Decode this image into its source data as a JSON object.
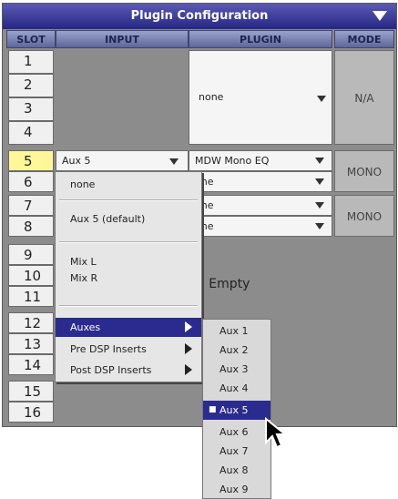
{
  "window": {
    "title": "Plugin Configuration"
  },
  "columns": {
    "slot": "SLOT",
    "input": "INPUT",
    "plugin": "PLUGIN",
    "mode": "MODE"
  },
  "slots": [
    "1",
    "2",
    "3",
    "4",
    "5",
    "6",
    "7",
    "8",
    "9",
    "10",
    "11",
    "12",
    "13",
    "14",
    "15",
    "16"
  ],
  "selected_slot": "5",
  "plugin_group1": {
    "value": "none",
    "mode": "N/A"
  },
  "row5": {
    "input": "Aux 5",
    "plugin": "MDW Mono EQ",
    "mode": "MONO"
  },
  "rows6to8": {
    "plugin6": "one",
    "plugin7": "one",
    "plugin8": "one",
    "mode": "MONO"
  },
  "empty_label": "C Empty",
  "input_menu": {
    "items": [
      "none",
      "Aux 5 (default)",
      "Mix L",
      "Mix R",
      "Auxes",
      "Pre DSP Inserts",
      "Post DSP Inserts"
    ],
    "selected": "Auxes"
  },
  "aux_submenu": {
    "items": [
      "Aux 1",
      "Aux 2",
      "Aux 3",
      "Aux 4",
      "Aux 5",
      "Aux 6",
      "Aux 7",
      "Aux 8",
      "Aux 9"
    ],
    "checked": "Aux 5"
  },
  "colors": {
    "title_bar": "#262685",
    "selection": "#2b2b8f",
    "selected_slot": "#fff799"
  }
}
